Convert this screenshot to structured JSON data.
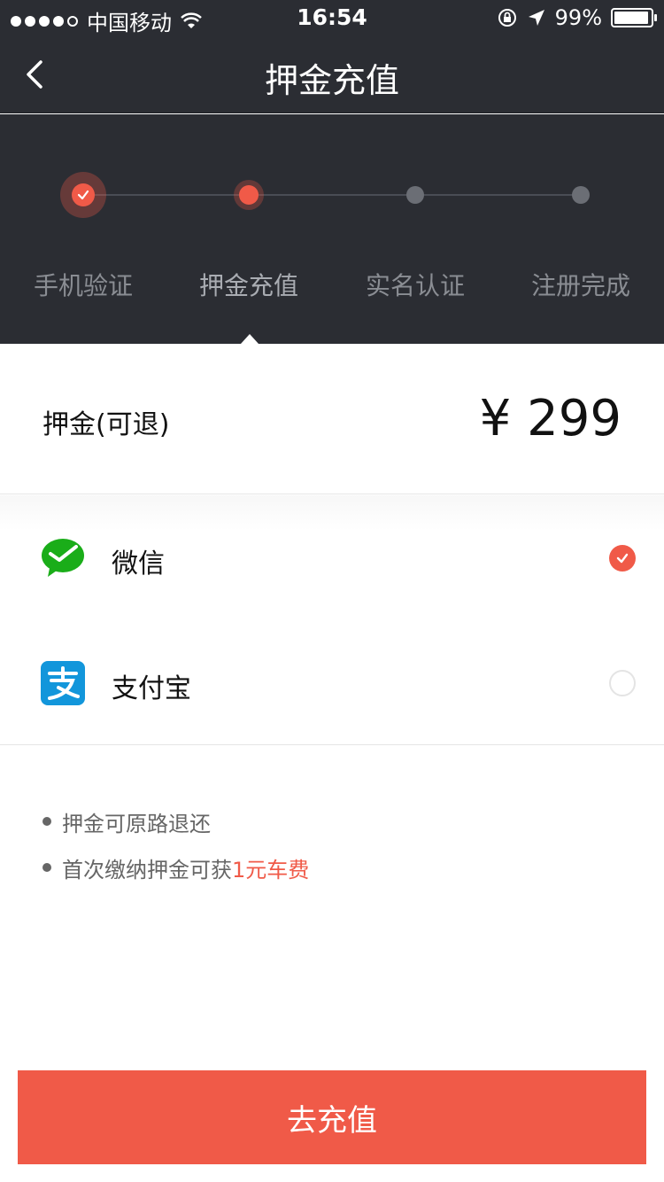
{
  "status_bar": {
    "carrier": "中国移动",
    "time": "16:54",
    "battery": "99%"
  },
  "nav": {
    "title": "押金充值"
  },
  "steps": [
    {
      "label": "手机验证",
      "state": "done"
    },
    {
      "label": "押金充值",
      "state": "current"
    },
    {
      "label": "实名认证",
      "state": "pending"
    },
    {
      "label": "注册完成",
      "state": "pending"
    }
  ],
  "deposit": {
    "label": "押金(可退)",
    "amount": "¥ 299"
  },
  "payment": {
    "methods": [
      {
        "label": "微信",
        "icon": "wechat-icon",
        "selected": true
      },
      {
        "label": "支付宝",
        "icon": "alipay-icon",
        "selected": false
      }
    ]
  },
  "notes": {
    "items": [
      {
        "text": "押金可原路退还",
        "highlight": ""
      },
      {
        "text": "首次缴纳押金可获",
        "highlight": "1元车费"
      }
    ]
  },
  "button": {
    "label": "去充值"
  },
  "colors": {
    "accent": "#f05a48",
    "dark_bg": "#2b2d33",
    "wechat_green": "#1aad19",
    "alipay_blue": "#1296db"
  }
}
